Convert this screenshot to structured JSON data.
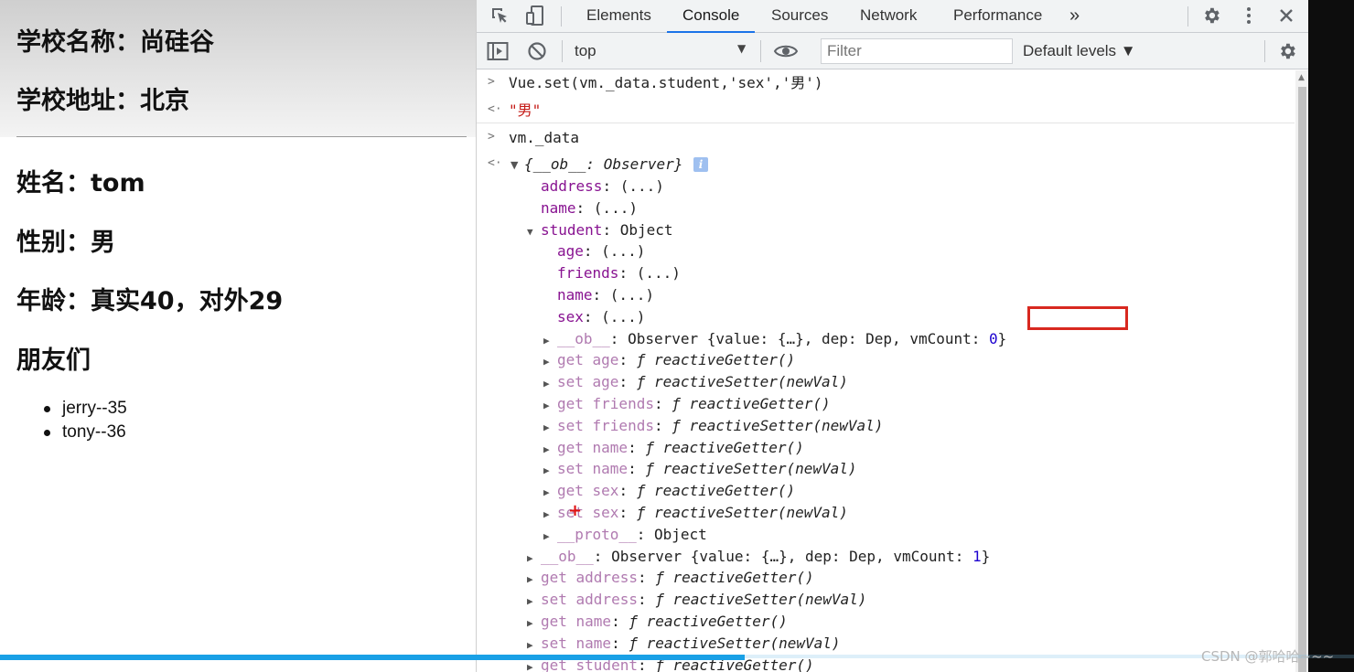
{
  "page": {
    "school_name": "学校名称：尚硅谷",
    "school_address": "学校地址：北京",
    "student_name": "姓名：tom",
    "student_sex": "性别：男",
    "student_age": "年龄：真实40，对外29",
    "friends_heading": "朋友们",
    "friends": [
      "jerry--35",
      "tony--36"
    ]
  },
  "devtools": {
    "tabs": [
      "Elements",
      "Console",
      "Sources",
      "Network",
      "Performance"
    ],
    "active_tab": "Console",
    "more_tabs_glyph": "»",
    "context": "top",
    "filter_placeholder": "Filter",
    "levels": "Default levels ▼",
    "icons": [
      "inspect-icon",
      "device-toggle-icon",
      "gear-icon",
      "kebab-menu-icon",
      "close-icon",
      "sidebar-toggle-icon",
      "clear-console-icon",
      "eye-icon"
    ]
  },
  "console": {
    "cmd1": "Vue.set(vm._data.student,'sex','男')",
    "res1": "\"男\"",
    "cmd2": "vm._data",
    "root_summary": "{__ob__: Observer}",
    "root_props": [
      {
        "key": "address",
        "val": ": (...)"
      },
      {
        "key": "name",
        "val": ": (...)"
      }
    ],
    "student_key": "student",
    "student_val": ": Object",
    "student_props": [
      {
        "key": "age",
        "val": ": (...)"
      },
      {
        "key": "friends",
        "val": ": (...)"
      },
      {
        "key": "name",
        "val": ": (...)"
      },
      {
        "key": "sex",
        "val": ": (...)"
      }
    ],
    "student_ob": {
      "key": "__ob__",
      "val": ": Observer {value: {…}, dep: Dep, vmCount: ",
      "count": "0",
      "end": "}"
    },
    "student_accessors": [
      {
        "key": "get age",
        "fn": "reactiveGetter()"
      },
      {
        "key": "set age",
        "fn": "reactiveSetter(newVal)"
      },
      {
        "key": "get friends",
        "fn": "reactiveGetter()"
      },
      {
        "key": "set friends",
        "fn": "reactiveSetter(newVal)"
      },
      {
        "key": "get name",
        "fn": "reactiveGetter()"
      },
      {
        "key": "set name",
        "fn": "reactiveSetter(newVal)"
      },
      {
        "key": "get sex",
        "fn": "reactiveGetter()"
      },
      {
        "key": "set sex",
        "fn": "reactiveSetter(newVal)"
      }
    ],
    "student_proto": {
      "key": "__proto__",
      "val": ": Object"
    },
    "root_ob": {
      "key": "__ob__",
      "val": ": Observer {value: {…}, dep: Dep, vmCount: ",
      "count": "1",
      "end": "}"
    },
    "root_accessors": [
      {
        "key": "get address",
        "fn": "reactiveGetter()"
      },
      {
        "key": "set address",
        "fn": "reactiveSetter(newVal)"
      },
      {
        "key": "get name",
        "fn": "reactiveGetter()"
      },
      {
        "key": "set name",
        "fn": "reactiveSetter(newVal)"
      },
      {
        "key": "get student",
        "fn": "reactiveGetter()"
      }
    ],
    "f_glyph": "ƒ"
  },
  "video": {
    "progress": 0.55
  },
  "watermark": "CSDN @郭哈哈~~~",
  "colors": {
    "key": "#881391",
    "dim_key": "#b07ab0",
    "string": "#c41a16",
    "number": "#1c00cf",
    "highlight": "#d8281f",
    "accent": "#1a73e8"
  }
}
